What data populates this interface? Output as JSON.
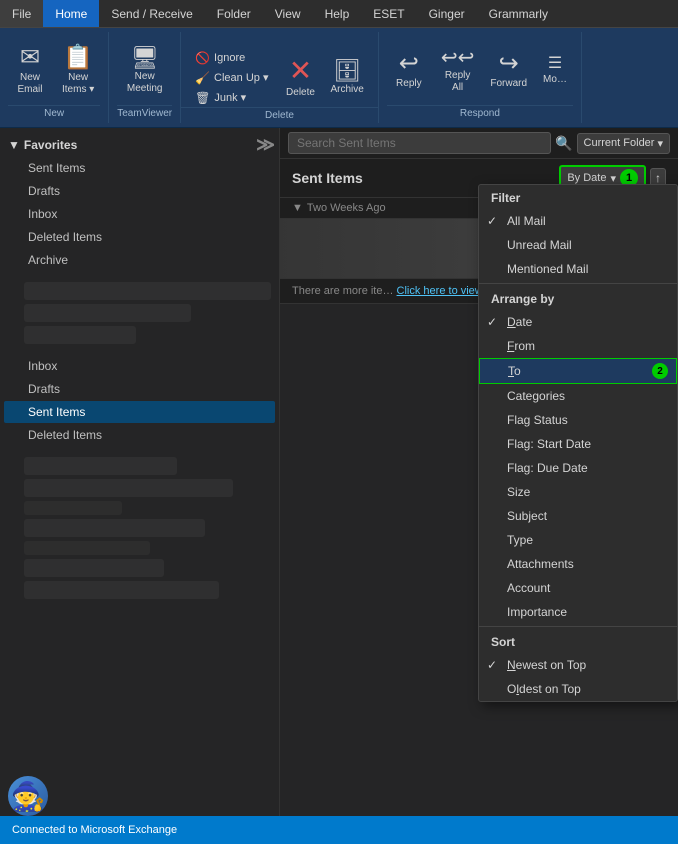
{
  "menubar": {
    "items": [
      {
        "label": "File",
        "active": false
      },
      {
        "label": "Home",
        "active": true
      },
      {
        "label": "Send / Receive",
        "active": false
      },
      {
        "label": "Folder",
        "active": false
      },
      {
        "label": "View",
        "active": false
      },
      {
        "label": "Help",
        "active": false
      },
      {
        "label": "ESET",
        "active": false
      },
      {
        "label": "Ginger",
        "active": false
      },
      {
        "label": "Grammarly",
        "active": false
      }
    ]
  },
  "ribbon": {
    "groups": [
      {
        "label": "New",
        "buttons": [
          {
            "icon": "✉",
            "label": "New\nEmail",
            "name": "new-email-button"
          },
          {
            "icon": "📋",
            "label": "New\nItems",
            "name": "new-items-button",
            "dropdown": true
          }
        ]
      },
      {
        "label": "TeamViewer",
        "buttons": [
          {
            "icon": "🖥",
            "label": "New\nMeeting",
            "name": "new-meeting-button"
          }
        ]
      },
      {
        "label": "Delete",
        "small_buttons": [
          {
            "icon": "🚫",
            "label": "Ignore",
            "name": "ignore-button"
          },
          {
            "icon": "🧹",
            "label": "Clean Up ▾",
            "name": "cleanup-button"
          },
          {
            "icon": "🗑",
            "label": "Junk ▾",
            "name": "junk-button"
          }
        ],
        "buttons": [
          {
            "icon": "❌",
            "label": "Delete",
            "name": "delete-button"
          },
          {
            "icon": "🗄",
            "label": "Archive",
            "name": "archive-button"
          }
        ]
      },
      {
        "label": "Respond",
        "buttons": [
          {
            "icon": "↩",
            "label": "Reply",
            "name": "reply-button"
          },
          {
            "icon": "↩↩",
            "label": "Reply\nAll",
            "name": "reply-all-button"
          },
          {
            "icon": "→",
            "label": "Forward",
            "name": "forward-button"
          },
          {
            "icon": "…",
            "label": "Mo…",
            "name": "more-respond-button"
          }
        ]
      }
    ]
  },
  "sidebar": {
    "favorites_label": "Favorites",
    "items": [
      {
        "label": "Sent Items",
        "active": false
      },
      {
        "label": "Drafts",
        "active": false
      },
      {
        "label": "Inbox",
        "active": false
      },
      {
        "label": "Deleted Items",
        "active": false
      },
      {
        "label": "Archive",
        "active": false
      }
    ],
    "mail_items": [
      {
        "label": "Inbox",
        "active": false
      },
      {
        "label": "Drafts",
        "active": false
      },
      {
        "label": "Sent Items",
        "active": true
      },
      {
        "label": "Deleted Items",
        "active": false
      }
    ]
  },
  "content": {
    "search_placeholder": "Search Sent Items",
    "search_scope": "Current Folder",
    "folder_title": "Sent Items",
    "sort_label": "By Date",
    "sort_badge": "1",
    "group_header": "Two Weeks Ago",
    "more_items_text": "There are more ite…",
    "more_items_link": "Click here to view…"
  },
  "dropdown": {
    "filter_header": "Filter",
    "filter_items": [
      {
        "label": "All Mail",
        "checked": true,
        "name": "all-mail-item"
      },
      {
        "label": "Unread Mail",
        "checked": false,
        "name": "unread-mail-item"
      },
      {
        "label": "Mentioned Mail",
        "checked": false,
        "name": "mentioned-mail-item"
      }
    ],
    "arrange_header": "Arrange by",
    "arrange_items": [
      {
        "label": "Date",
        "checked": true,
        "underline_idx": 0,
        "name": "date-item"
      },
      {
        "label": "From",
        "checked": false,
        "underline_idx": 0,
        "name": "from-item"
      },
      {
        "label": "To",
        "checked": false,
        "highlighted": true,
        "badge": "2",
        "name": "to-item"
      },
      {
        "label": "Categories",
        "checked": false,
        "name": "categories-item"
      },
      {
        "label": "Flag Status",
        "checked": false,
        "name": "flag-status-item"
      },
      {
        "label": "Flag: Start Date",
        "checked": false,
        "name": "flag-start-date-item"
      },
      {
        "label": "Flag: Due Date",
        "checked": false,
        "name": "flag-due-date-item"
      },
      {
        "label": "Size",
        "checked": false,
        "name": "size-item"
      },
      {
        "label": "Subject",
        "checked": false,
        "name": "subject-item"
      },
      {
        "label": "Type",
        "checked": false,
        "name": "type-item"
      },
      {
        "label": "Attachments",
        "checked": false,
        "name": "attachments-item"
      },
      {
        "label": "Account",
        "checked": false,
        "name": "account-item"
      },
      {
        "label": "Importance",
        "checked": false,
        "name": "importance-item"
      }
    ],
    "sort_header": "Sort",
    "sort_items": [
      {
        "label": "Newest on Top",
        "checked": true,
        "name": "newest-on-top-item"
      },
      {
        "label": "Oldest on Top",
        "checked": false,
        "name": "oldest-on-top-item"
      }
    ]
  },
  "statusbar": {
    "text": "Connected to Microsoft Exchange"
  }
}
